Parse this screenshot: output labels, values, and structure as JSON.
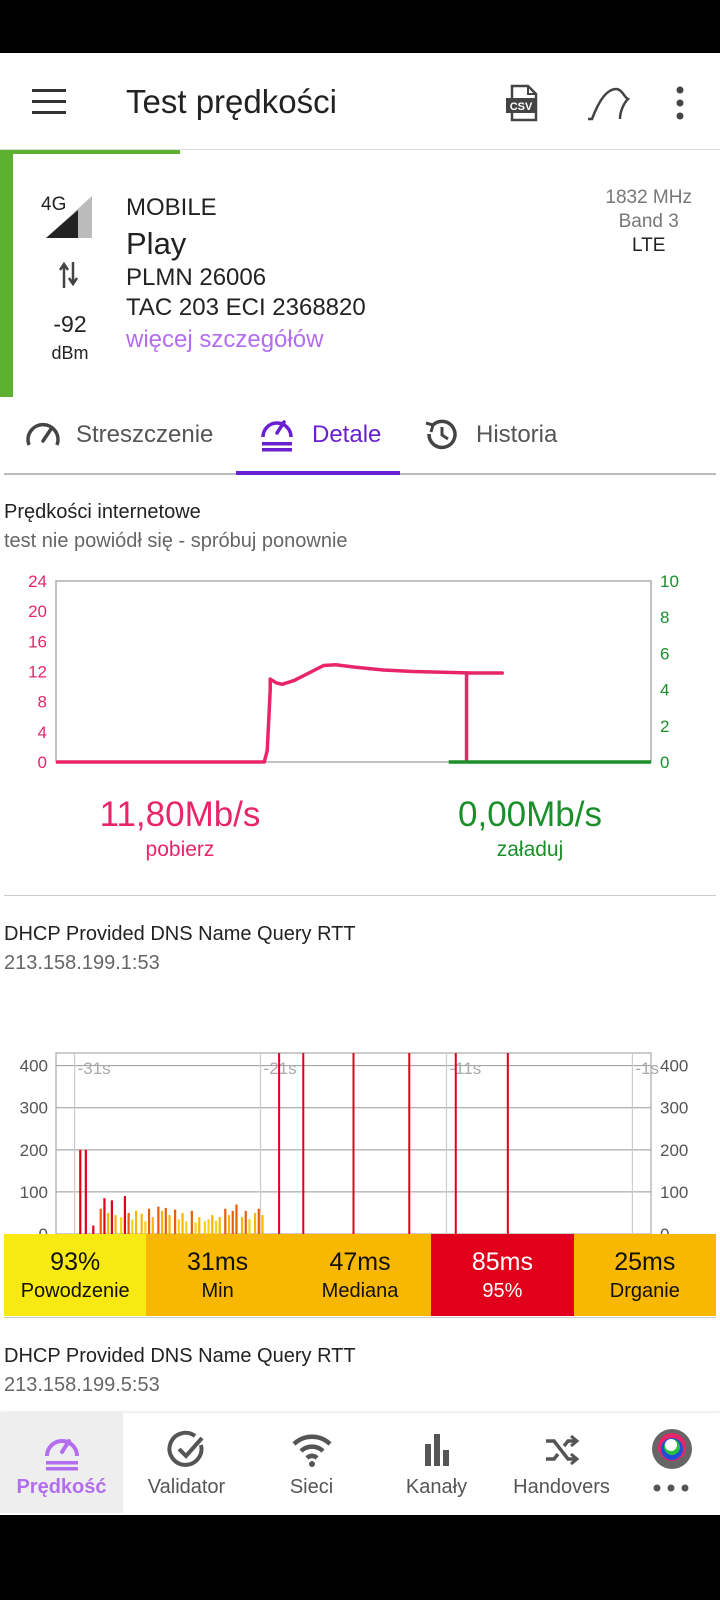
{
  "app": {
    "title": "Test prędkości",
    "progress": 0.5,
    "colors": {
      "accent": "#6a1fd0",
      "accent_light": "#b36ef0",
      "green": "#5cb130",
      "download": "#e8256a",
      "upload": "#1b8f2a"
    }
  },
  "toolbar": {
    "menu_icon": "menu-icon",
    "csv_icon": "csv-icon",
    "csv_text": "CSV",
    "curve_icon": "curve-icon",
    "more_icon": "more-vert-icon"
  },
  "cell": {
    "tech_badge": "4G",
    "signal_icon": "signal-strength-icon",
    "transfer_icon": "data-transfer-icon",
    "dbm": "-92",
    "dbm_unit": "dBm",
    "type": "MOBILE",
    "operator": "Play",
    "plmn": "PLMN 26006",
    "tac_eci": "TAC 203 ECI 2368820",
    "more_link": "więcej szczegółów",
    "frequency": "1832 MHz",
    "band": "Band 3",
    "technology": "LTE"
  },
  "tabs": [
    {
      "label": "Streszczenie",
      "icon": "speedometer-icon"
    },
    {
      "label": "Detale",
      "icon": "speed-detail-icon",
      "active": true
    },
    {
      "label": "Historia",
      "icon": "history-icon"
    }
  ],
  "speed_section": {
    "title": "Prędkości internetowe",
    "subtitle": "test nie powiódł się - spróbuj ponownie",
    "download_value": "11,80Mb/s",
    "download_label": "pobierz",
    "upload_value": "0,00Mb/s",
    "upload_label": "załaduj"
  },
  "dns_section": {
    "title": "DHCP Provided DNS Name Query RTT",
    "server": "213.158.199.1:53",
    "stats": [
      {
        "value": "93%",
        "label": "Powodzenie",
        "color": "#f9e913"
      },
      {
        "value": "31ms",
        "label": "Min",
        "color": "#f8b700"
      },
      {
        "value": "47ms",
        "label": "Mediana",
        "color": "#f8b700"
      },
      {
        "value": "85ms",
        "label": "95%",
        "color": "#e0001b"
      },
      {
        "value": "25ms",
        "label": "Drganie",
        "color": "#f8b700"
      }
    ]
  },
  "dns_section2": {
    "title": "DHCP Provided DNS Name Query RTT",
    "server": "213.158.199.5:53"
  },
  "bottom_nav": [
    {
      "label": "Prędkość",
      "icon": "speed-icon",
      "active": true
    },
    {
      "label": "Validator",
      "icon": "check-circle-icon"
    },
    {
      "label": "Sieci",
      "icon": "wifi-icon"
    },
    {
      "label": "Kanały",
      "icon": "bar-chart-icon"
    },
    {
      "label": "Handovers",
      "icon": "shuffle-icon"
    },
    {
      "label": "",
      "icon": "app-logo-icon"
    }
  ],
  "chart_data": [
    {
      "type": "line",
      "title": "Prędkości internetowe",
      "y_left_ticks": [
        0,
        4,
        8,
        12,
        16,
        20,
        24
      ],
      "y_right_ticks": [
        0,
        2,
        4,
        6,
        8,
        10
      ],
      "ylim_left": [
        0,
        24
      ],
      "ylim_right": [
        0,
        10
      ],
      "series": [
        {
          "name": "pobierz",
          "axis": "left",
          "color": "#e8256a",
          "x": [
            0,
            35,
            35.5,
            36,
            36,
            37,
            38,
            40,
            43,
            45,
            47,
            50,
            55,
            60,
            65,
            70,
            75,
            69,
            69
          ],
          "y": [
            0,
            0,
            1.5,
            9.5,
            11,
            10.5,
            10.3,
            10.8,
            12.0,
            12.8,
            12.9,
            12.6,
            12.2,
            12.0,
            11.9,
            11.8,
            11.8,
            11.8,
            0
          ]
        },
        {
          "name": "załaduj",
          "axis": "right",
          "color": "#1b8f2a",
          "x": [
            66,
            100
          ],
          "y": [
            0,
            0
          ]
        }
      ],
      "grid": false
    },
    {
      "type": "bar",
      "title": "DHCP Provided DNS Name Query RTT",
      "x_ticks": [
        "-31s",
        "-21s",
        "-11s",
        "-1s"
      ],
      "y_ticks": [
        0,
        100,
        200,
        300,
        400
      ],
      "ylim": [
        0,
        430
      ],
      "grid": true,
      "failures_color": "#e0001b",
      "failure_times_s": [
        -20,
        -18.7,
        -16,
        -13,
        -10.5,
        -7.7
      ],
      "bars": [
        {
          "t": -30.7,
          "v": 200,
          "c": "#e0001b"
        },
        {
          "t": -30.4,
          "v": 200,
          "c": "#e0001b"
        },
        {
          "t": -30.0,
          "v": 20,
          "c": "#e0001b"
        },
        {
          "t": -29.6,
          "v": 60,
          "c": "#e85c0a"
        },
        {
          "t": -29.4,
          "v": 85,
          "c": "#e0001b"
        },
        {
          "t": -29.2,
          "v": 50,
          "c": "#f8b700"
        },
        {
          "t": -29.0,
          "v": 80,
          "c": "#e0001b"
        },
        {
          "t": -28.8,
          "v": 45,
          "c": "#f8b700"
        },
        {
          "t": -28.5,
          "v": 40,
          "c": "#f9d313"
        },
        {
          "t": -28.3,
          "v": 90,
          "c": "#e0001b"
        },
        {
          "t": -28.1,
          "v": 50,
          "c": "#e85c0a"
        },
        {
          "t": -27.9,
          "v": 35,
          "c": "#f9d313"
        },
        {
          "t": -27.7,
          "v": 55,
          "c": "#f8b700"
        },
        {
          "t": -27.4,
          "v": 48,
          "c": "#f8b700"
        },
        {
          "t": -27.2,
          "v": 30,
          "c": "#f9d313"
        },
        {
          "t": -27.0,
          "v": 60,
          "c": "#e85c0a"
        },
        {
          "t": -26.8,
          "v": 40,
          "c": "#f8b700"
        },
        {
          "t": -26.5,
          "v": 65,
          "c": "#e85c0a"
        },
        {
          "t": -26.3,
          "v": 55,
          "c": "#f8b700"
        },
        {
          "t": -26.1,
          "v": 62,
          "c": "#e85c0a"
        },
        {
          "t": -25.9,
          "v": 45,
          "c": "#f8b700"
        },
        {
          "t": -25.6,
          "v": 58,
          "c": "#e85c0a"
        },
        {
          "t": -25.4,
          "v": 35,
          "c": "#f9d313"
        },
        {
          "t": -25.2,
          "v": 50,
          "c": "#f8b700"
        },
        {
          "t": -25.0,
          "v": 30,
          "c": "#f9d313"
        },
        {
          "t": -24.7,
          "v": 55,
          "c": "#e85c0a"
        },
        {
          "t": -24.5,
          "v": 28,
          "c": "#f9d313"
        },
        {
          "t": -24.3,
          "v": 40,
          "c": "#f8b700"
        },
        {
          "t": -24.0,
          "v": 30,
          "c": "#f9d313"
        },
        {
          "t": -23.8,
          "v": 35,
          "c": "#f9d313"
        },
        {
          "t": -23.6,
          "v": 45,
          "c": "#f8b700"
        },
        {
          "t": -23.4,
          "v": 32,
          "c": "#f9d313"
        },
        {
          "t": -23.2,
          "v": 40,
          "c": "#f8b700"
        },
        {
          "t": -22.9,
          "v": 60,
          "c": "#e85c0a"
        },
        {
          "t": -22.7,
          "v": 45,
          "c": "#f8b700"
        },
        {
          "t": -22.5,
          "v": 55,
          "c": "#e85c0a"
        },
        {
          "t": -22.3,
          "v": 70,
          "c": "#e85c0a"
        },
        {
          "t": -22.0,
          "v": 40,
          "c": "#f8b700"
        },
        {
          "t": -21.8,
          "v": 55,
          "c": "#e85c0a"
        },
        {
          "t": -21.6,
          "v": 35,
          "c": "#f9d313"
        },
        {
          "t": -21.3,
          "v": 50,
          "c": "#f8b700"
        },
        {
          "t": -21.1,
          "v": 60,
          "c": "#e85c0a"
        },
        {
          "t": -20.9,
          "v": 45,
          "c": "#f8b700"
        }
      ]
    }
  ]
}
